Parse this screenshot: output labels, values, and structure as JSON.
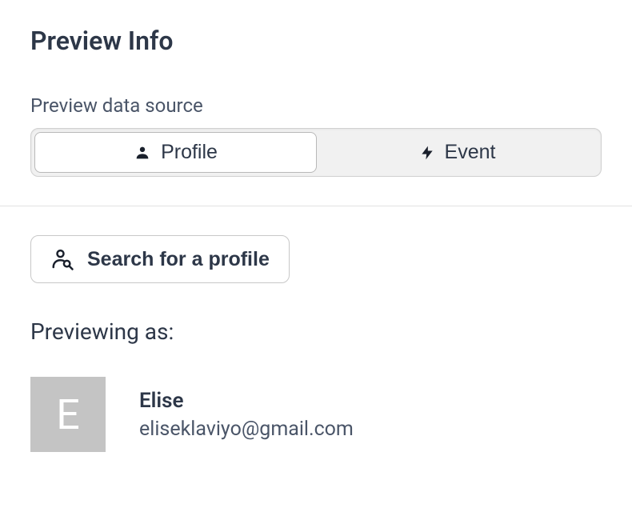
{
  "header": {
    "title": "Preview Info",
    "data_source_label": "Preview data source"
  },
  "segments": {
    "profile_label": "Profile",
    "event_label": "Event"
  },
  "search": {
    "button_label": "Search for a profile"
  },
  "preview": {
    "previewing_as_label": "Previewing as:",
    "profile": {
      "name": "Elise",
      "email": "eliseklaviyo@gmail.com",
      "avatar_initial": "E"
    }
  }
}
